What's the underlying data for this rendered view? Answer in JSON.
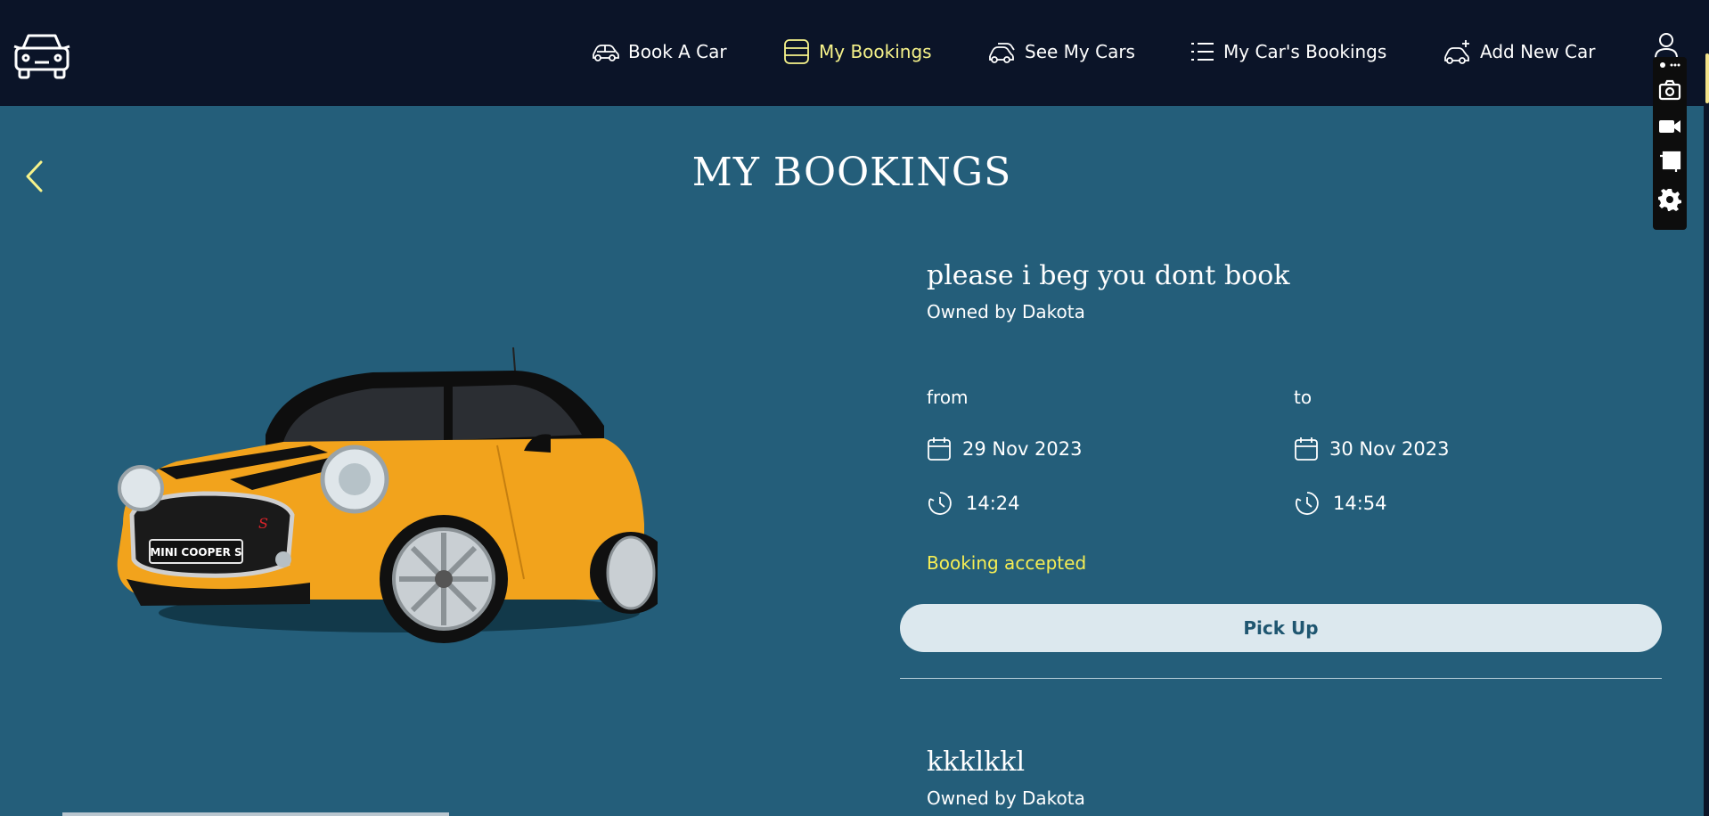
{
  "nav": {
    "items": [
      {
        "label": "Book A Car",
        "icon": "car-icon"
      },
      {
        "label": "My Bookings",
        "icon": "bookings-icon",
        "active": true
      },
      {
        "label": "See My Cars",
        "icon": "cars-icon"
      },
      {
        "label": "My Car's Bookings",
        "icon": "list-icon"
      },
      {
        "label": "Add New Car",
        "icon": "car-add-icon"
      }
    ],
    "active_color": "#f7f38a"
  },
  "page": {
    "title": "MY BOOKINGS"
  },
  "car": {
    "plate": "MINI COOPER S",
    "body_color": "#f2a31c"
  },
  "bookings": [
    {
      "title": "please i beg you dont book",
      "owner": "Owned by Dakota",
      "from_label": "from",
      "to_label": "to",
      "from_date": "29 Nov 2023",
      "to_date": "30 Nov 2023",
      "from_time": "14:24",
      "to_time": "14:54",
      "status": "Booking accepted",
      "action": "Pick Up"
    },
    {
      "title": "kkklkkl",
      "owner": "Owned by Dakota"
    }
  ],
  "colors": {
    "background": "#245e7a",
    "navbar": "#0b1428",
    "status": "#f6ee54",
    "button_bg": "#dce8ee",
    "button_text": "#1f5670"
  }
}
